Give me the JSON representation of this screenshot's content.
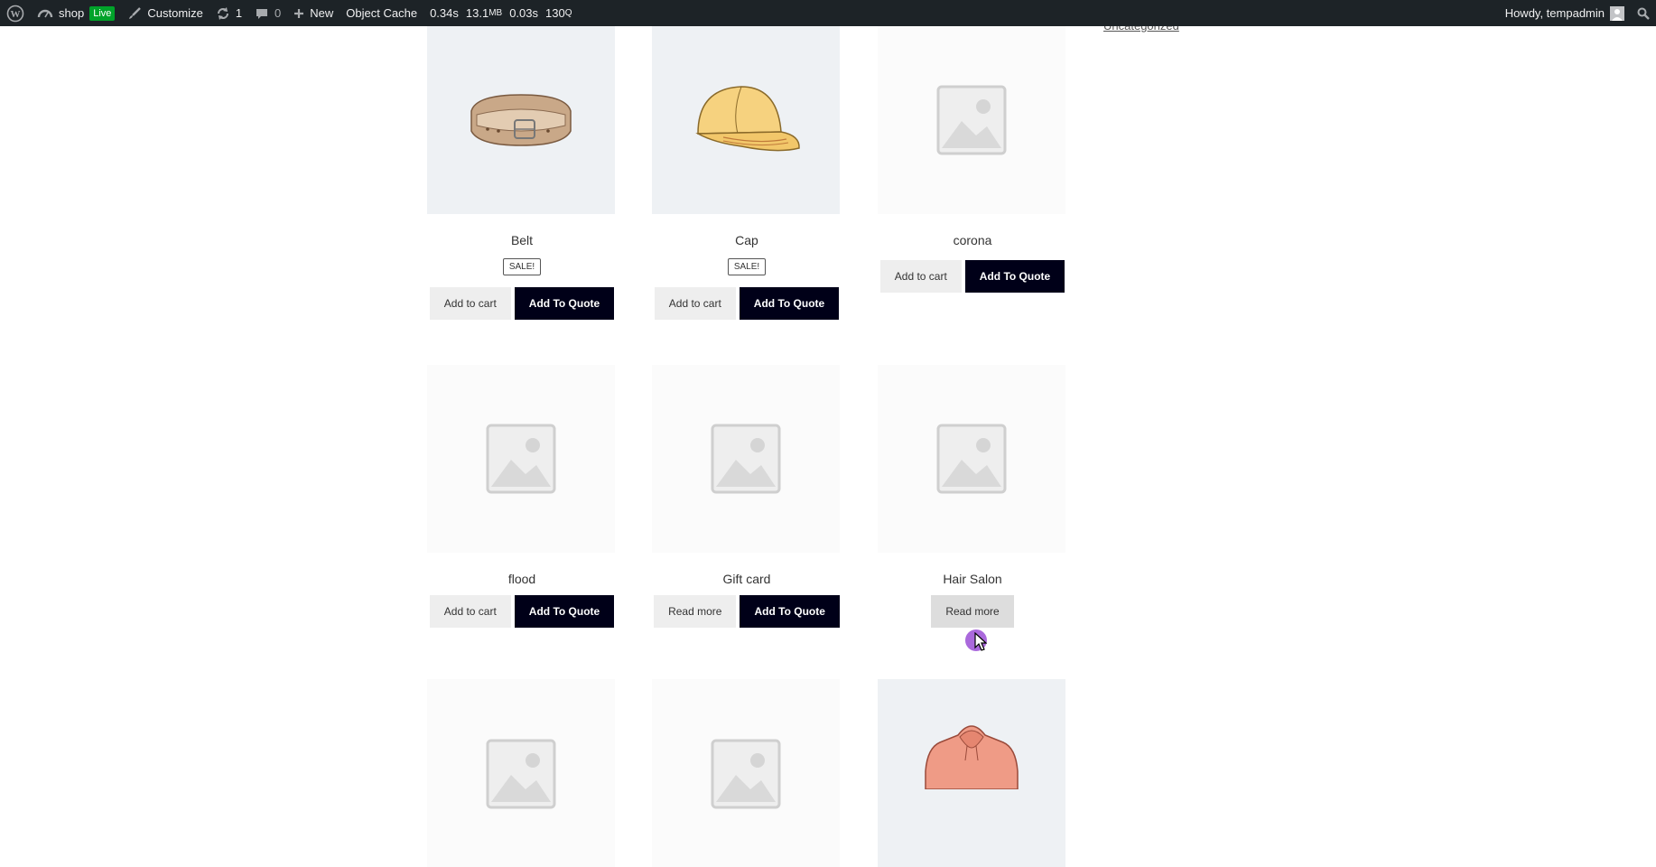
{
  "adminbar": {
    "site_name": "shop",
    "live_badge": "Live",
    "customize": "Customize",
    "updates_count": "1",
    "comments_count": "0",
    "new_label": "New",
    "object_cache": "Object Cache",
    "perf_time": "0.34s",
    "perf_mem": "13.1",
    "perf_mem_unit": "MB",
    "perf_db_time": "0.03s",
    "perf_queries": "130",
    "perf_queries_unit": "Q",
    "howdy": "Howdy, tempadmin"
  },
  "category_link": "Uncategorized",
  "products": [
    {
      "name": "Belt",
      "sale": "SALE!",
      "btn1": "Add to cart",
      "btn2": "Add To Quote"
    },
    {
      "name": "Cap",
      "sale": "SALE!",
      "btn1": "Add to cart",
      "btn2": "Add To Quote"
    },
    {
      "name": "corona",
      "btn1": "Add to cart",
      "btn2": "Add To Quote"
    },
    {
      "name": "flood",
      "btn1": "Add to cart",
      "btn2": "Add To Quote"
    },
    {
      "name": "Gift card",
      "btn1": "Read more",
      "btn2": "Add To Quote"
    },
    {
      "name": "Hair Salon",
      "btn1": "Read more"
    }
  ],
  "colors": {
    "adminbar": "#1d2327",
    "quote_button": "#000018",
    "live_badge": "#00a32a"
  }
}
